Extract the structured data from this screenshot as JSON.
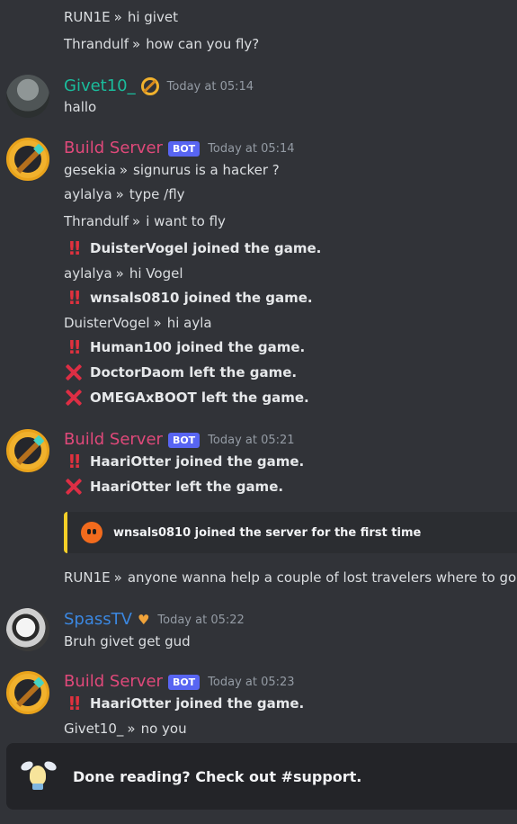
{
  "colors": {
    "background": "#313338",
    "build_server": "#e0497a",
    "givet": "#1abc9c",
    "spasstv": "#3b87e0",
    "bot_badge": "#5865f2",
    "embed_bar": "#f5cf27"
  },
  "top_lines": [
    {
      "user": "RUN1E",
      "text": "hi givet"
    },
    {
      "user": "Thrandulf",
      "text": "how can you fly?"
    }
  ],
  "group_givet": {
    "username": "Givet10_",
    "badge_icon": "slash-badge-icon",
    "timestamp": "Today at 05:14",
    "text": "hallo"
  },
  "group_build_1": {
    "username": "Build Server",
    "bot": "BOT",
    "timestamp": "Today at 05:14",
    "lines": [
      {
        "user": "gesekia",
        "text": "signurus is a hacker ?"
      },
      {
        "user": "aylalya",
        "text": "type /fly"
      },
      {
        "user": "Thrandulf",
        "text": "i want to fly"
      }
    ],
    "e1": "DuisterVogel joined the game.",
    "l4": {
      "user": "aylalya",
      "text": "hi Vogel"
    },
    "e2": "wnsals0810 joined the game.",
    "l5": {
      "user": "DuisterVogel",
      "text": "hi ayla"
    },
    "e3": "Human100 joined the game.",
    "e4": "DoctorDaom left the game.",
    "e5": "OMEGAxBOOT left the game."
  },
  "group_build_2": {
    "username": "Build Server",
    "bot": "BOT",
    "timestamp": "Today at 05:21",
    "e1": "HaariOtter joined the game.",
    "e2": "HaariOtter left the game.",
    "embed": "wnsals0810 joined the server for the first time",
    "line": {
      "user": "RUN1E",
      "text": "anyone wanna help a couple of lost travelers where to go"
    }
  },
  "group_spass": {
    "username": "SpassTV",
    "badge_icon": "heart-badge-icon",
    "timestamp": "Today at 05:22",
    "text": "Bruh givet get gud"
  },
  "group_build_3": {
    "username": "Build Server",
    "bot": "BOT",
    "timestamp": "Today at 05:23",
    "e1": "HaariOtter joined the game.",
    "line": {
      "user": "Givet10_",
      "text": "no you"
    }
  },
  "notice": {
    "text": "Done reading? Check out #support."
  },
  "separator": "»",
  "bang": "‼",
  "heart": "♥"
}
